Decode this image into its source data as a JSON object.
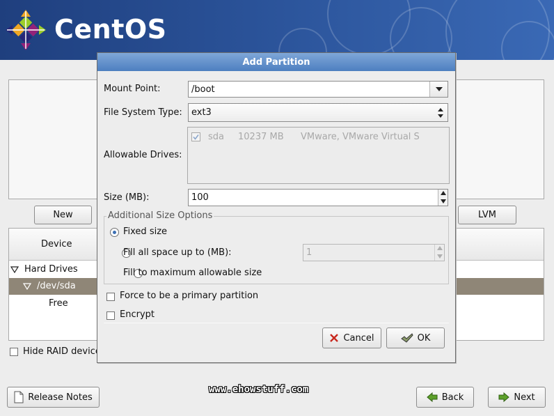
{
  "header": {
    "logo_text": "CentOS"
  },
  "installer": {
    "new_button": "New",
    "lvm_button": "LVM",
    "device_column": "Device",
    "tree": [
      "Hard Drives",
      "/dev/sda",
      "Free"
    ],
    "hide_raid_label": "Hide RAID device",
    "release_notes_button": "Release Notes",
    "back_button": "Back",
    "next_button": "Next",
    "watermark": "www.ehowstuff.com"
  },
  "dialog": {
    "title": "Add Partition",
    "mount_point_label": "Mount Point:",
    "mount_point_value": "/boot",
    "fs_type_label": "File System Type:",
    "fs_type_value": "ext3",
    "allowable_drives_label": "Allowable Drives:",
    "drives": [
      {
        "name": "sda",
        "size": "10237 MB",
        "model": "VMware, VMware Virtual S",
        "checked": true
      }
    ],
    "size_label": "Size (MB):",
    "size_value": "100",
    "size_options_legend": "Additional Size Options",
    "opt_fixed": "Fixed size",
    "opt_fill_upto": "Fill all space up to (MB):",
    "fill_upto_value": "1",
    "opt_fill_max": "Fill to maximum allowable size",
    "force_primary_label": "Force to be a primary partition",
    "encrypt_label": "Encrypt",
    "cancel_button": "Cancel",
    "ok_button": "OK"
  },
  "colors": {
    "banner": "#2a5298",
    "dialog_title": "#5a89c6",
    "selected_row": "#8f8677"
  }
}
